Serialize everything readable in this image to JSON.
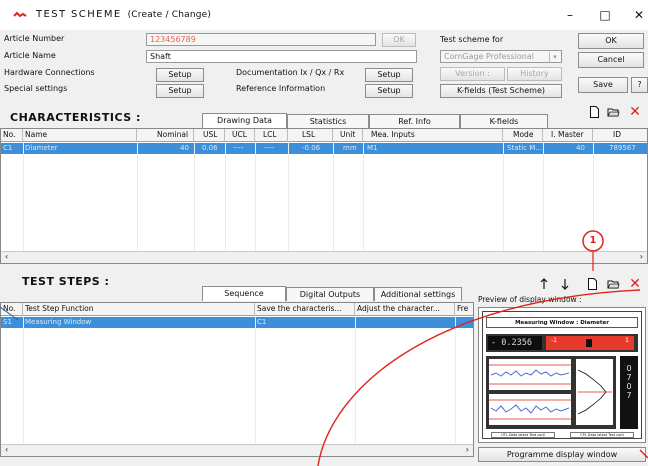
{
  "window": {
    "title": "TEST SCHEME",
    "subtitle": "(Create / Change)",
    "minimize": "–",
    "maximize": "□",
    "close": "✕"
  },
  "header": {
    "article_number_label": "Article Number",
    "article_number_value": "123456789",
    "article_name_label": "Article Name",
    "article_name_value": "Shaft",
    "ok_small": "OK",
    "hardware_label": "Hardware Connections",
    "special_label": "Special settings",
    "setup": "Setup",
    "documentation_label": "Documentation Ix / Qx / Rx",
    "reference_label": "Reference Information",
    "test_scheme_for_label": "Test scheme for",
    "test_scheme_for_value": "ComGage Professional",
    "version_label": "Version :",
    "history_label": "History",
    "kfields_button": "K-fields (Test Scheme)",
    "ok": "OK",
    "cancel": "Cancel",
    "save": "Save",
    "help": "?"
  },
  "characteristics": {
    "title": "CHARACTERISTICS :",
    "tabs": [
      "Drawing Data",
      "Statistics",
      "Ref. Info",
      "K-fields"
    ],
    "columns": [
      "No.",
      "Name",
      "Nominal",
      "USL",
      "UCL",
      "LCL",
      "LSL",
      "Unit",
      "Mea. Inputs",
      "Mode",
      "I. Master",
      "ID"
    ],
    "rows": [
      [
        "C1",
        "Diameter",
        "40",
        "0.06",
        "----",
        "----",
        "-0.06",
        "mm",
        "M1",
        "Static M...",
        "40",
        "789567"
      ]
    ]
  },
  "test_steps": {
    "title": "TEST  STEPS :",
    "tabs": [
      "Sequence",
      "Digital Outputs",
      "Additional settings"
    ],
    "columns": [
      "No.",
      "Test Step Function",
      "Save the characteris...",
      "Adjust the character...",
      "Fre"
    ],
    "rows": [
      [
        "S1",
        "Measuring Window",
        "C1",
        "",
        ""
      ]
    ]
  },
  "preview": {
    "label": "Preview of display window :",
    "window_title": "Measuring Window : Diameter",
    "reading": "- 0.2356",
    "bar_left": "-1",
    "bar_right": "1",
    "side_digits": [
      "0",
      "7",
      "0",
      "7"
    ],
    "footer_left": "UTL  Data latest    Test cont",
    "footer_right": "CPL  Data latest    Test cont",
    "programme_button": "Programme display window"
  },
  "callout": {
    "number": "1"
  },
  "icons": {
    "new": "new-document-icon",
    "open": "open-folder-icon",
    "delete": "delete-x-icon",
    "up": "move-up-icon",
    "down": "move-down-icon"
  },
  "colors": {
    "selection": "#3c8fd8",
    "annotation": "#e0241b",
    "article_number": "#e06a52"
  }
}
